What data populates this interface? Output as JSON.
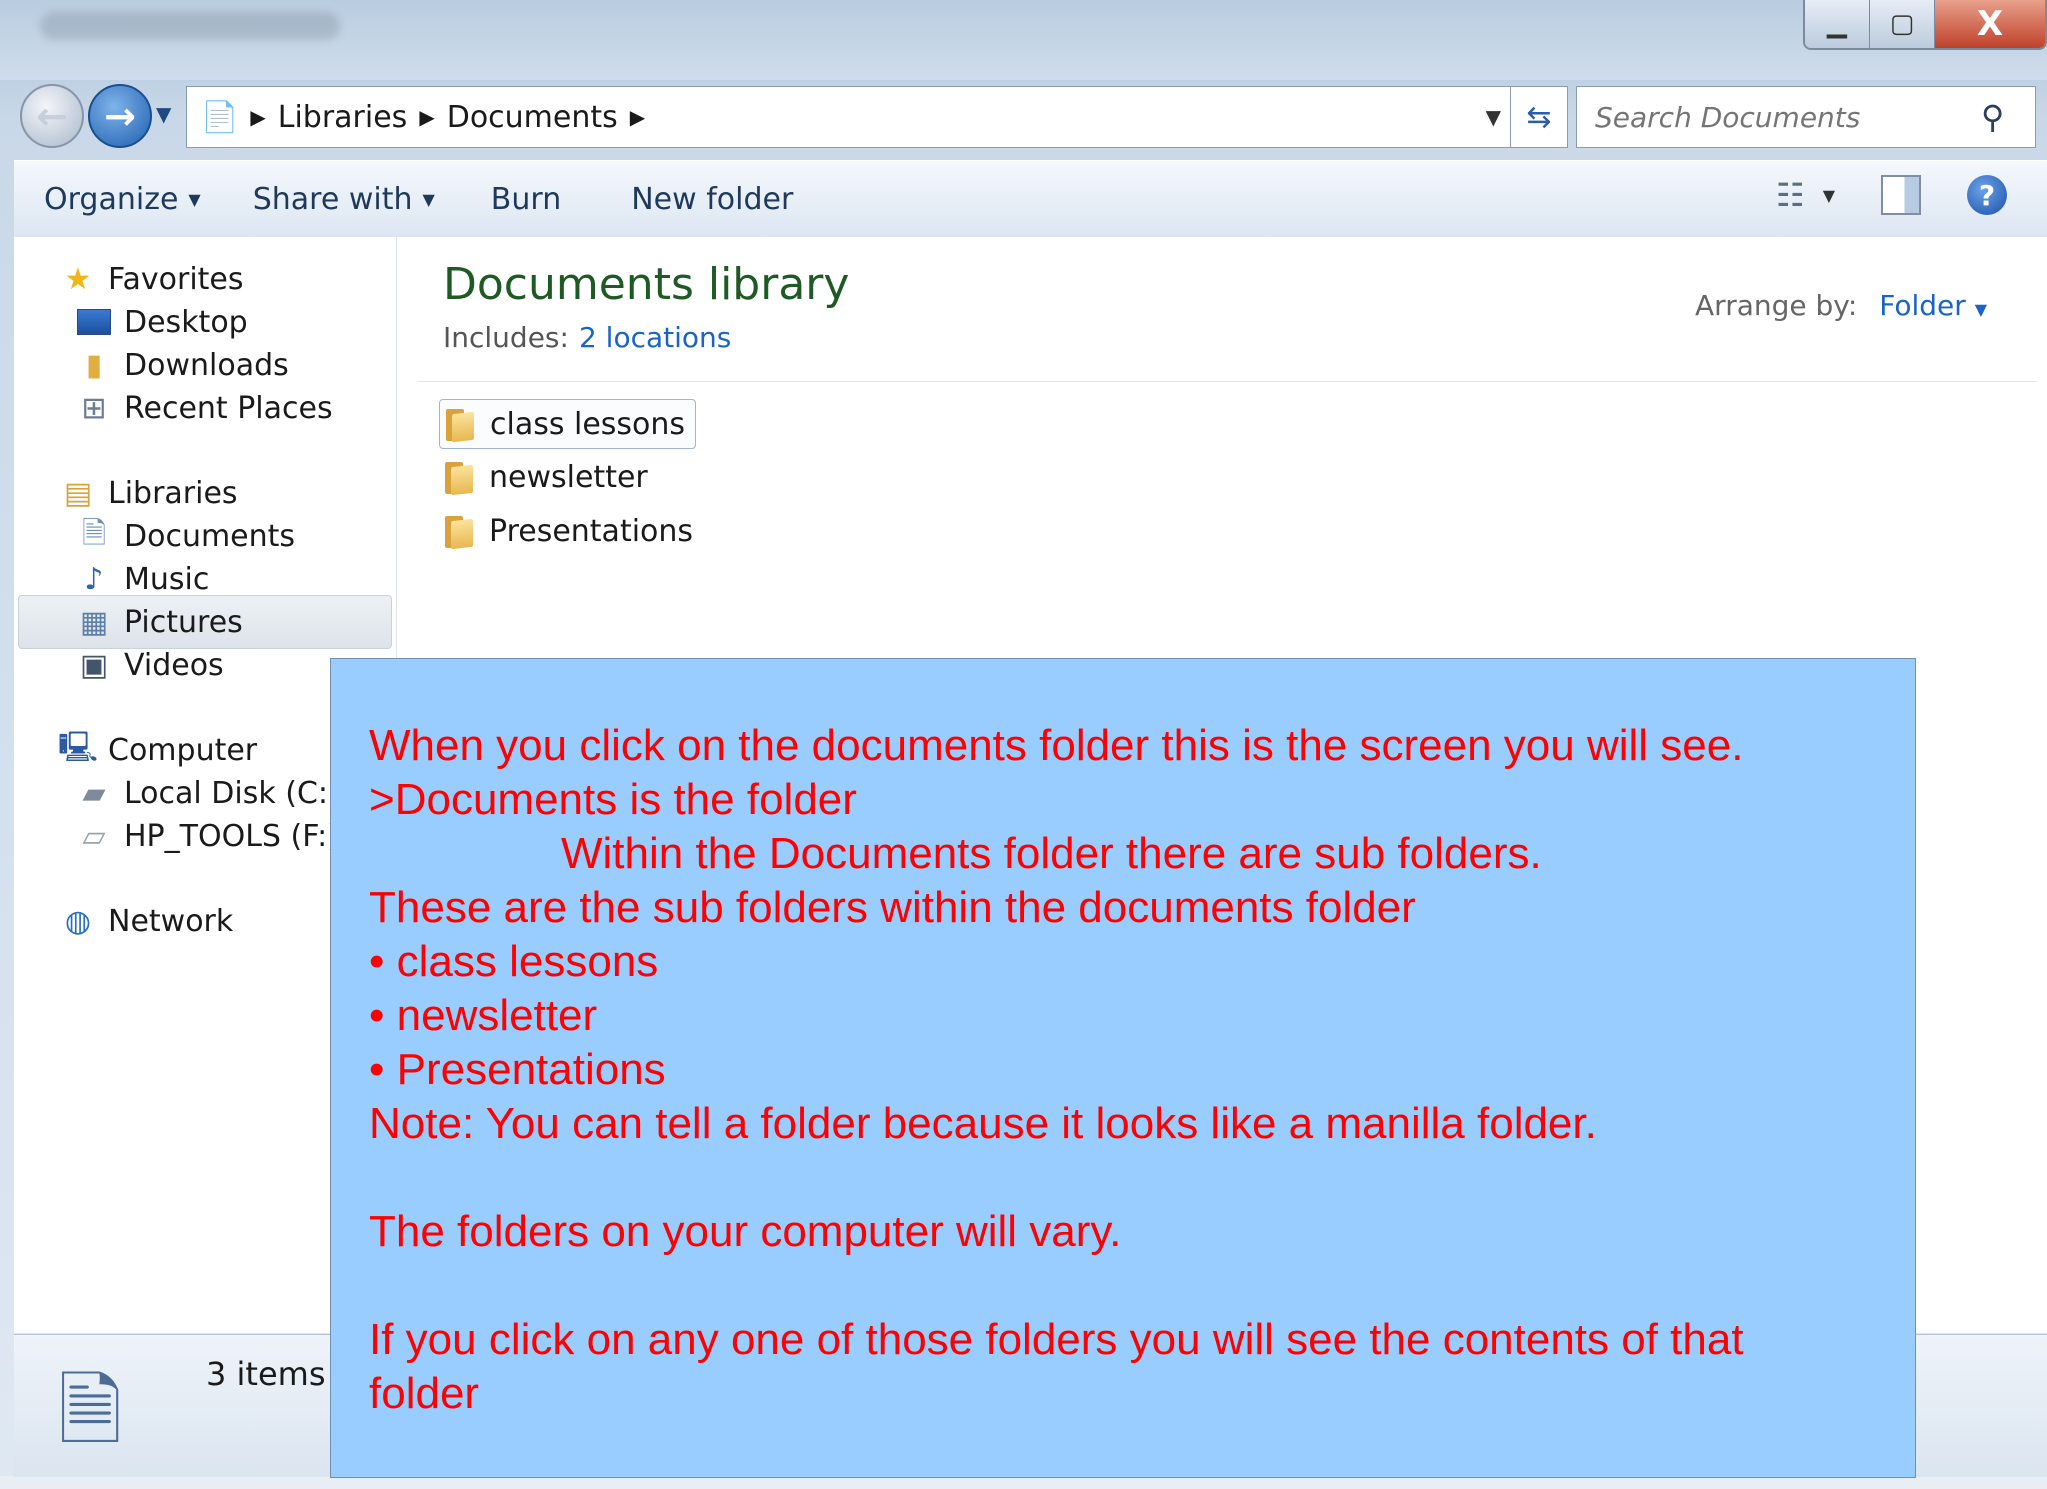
{
  "window": {
    "controls": [
      "minimize",
      "maximize",
      "close"
    ],
    "close_label": "X"
  },
  "nav": {
    "back_icon": "back-arrow-icon",
    "forward_icon": "forward-arrow-icon"
  },
  "address": {
    "crumbs": [
      "Libraries",
      "Documents"
    ]
  },
  "search": {
    "placeholder": "Search Documents"
  },
  "toolbar": {
    "organize": "Organize",
    "share_with": "Share with",
    "burn": "Burn",
    "new_folder": "New folder"
  },
  "sidebar": {
    "favorites": "Favorites",
    "desktop": "Desktop",
    "downloads": "Downloads",
    "recent_places": "Recent Places",
    "libraries": "Libraries",
    "documents": "Documents",
    "music": "Music",
    "pictures": "Pictures",
    "videos": "Videos",
    "computer": "Computer",
    "local_disk": "Local Disk (C:)",
    "hp_tools": "HP_TOOLS (F:)",
    "network": "Network"
  },
  "content": {
    "title": "Documents library",
    "includes_label": "Includes:",
    "includes_link": "2 locations",
    "arrange_label": "Arrange by:",
    "arrange_value": "Folder",
    "folders": [
      "class lessons",
      "newsletter",
      "Presentations"
    ]
  },
  "status": {
    "items": "3 items"
  },
  "overlay": {
    "line1": "When you click on the documents folder this is the screen you will see.",
    "line2": ">Documents is the folder",
    "line3": "Within the Documents folder there are  sub folders.",
    "line4": "These are the sub folders within the documents folder",
    "bullet1": "• class lessons",
    "bullet2": "• newsletter",
    "bullet3": "• Presentations",
    "note": "Note:  You can tell a folder because it looks like a manilla folder.",
    "vary": "The folders on your computer will vary.",
    "click1": "If you click on any one of those folders you will see the contents of that",
    "click2": "folder"
  }
}
